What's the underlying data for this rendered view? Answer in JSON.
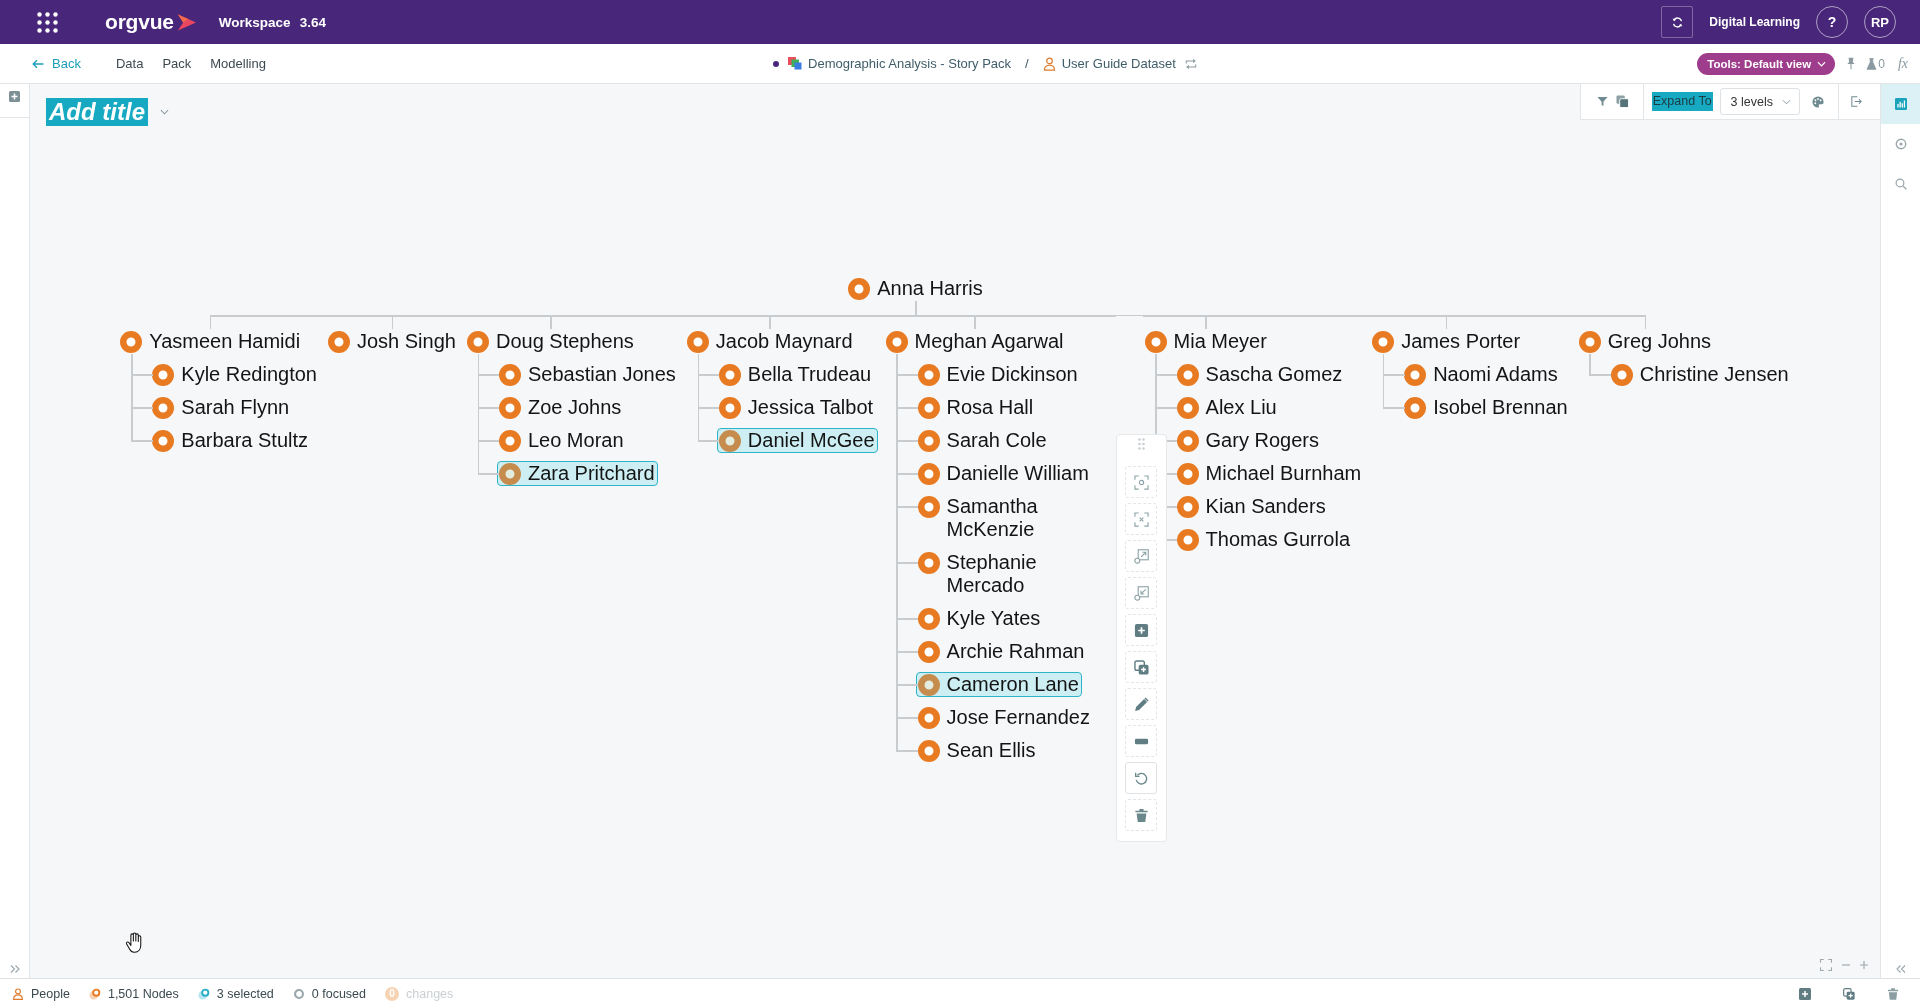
{
  "header": {
    "app_name": "orgvue",
    "product": "Workspace",
    "version": "3.64",
    "organisation": "Digital Learning",
    "help": "?",
    "avatar_initials": "RP"
  },
  "subbar": {
    "back": "Back",
    "nav": [
      "Data",
      "Pack",
      "Modelling"
    ],
    "breadcrumb": {
      "pack": "Demographic Analysis - Story Pack",
      "separator": "/",
      "dataset": "User Guide Dataset"
    },
    "tools_button": "Tools: Default view",
    "flask_count": "0",
    "formula": "fx"
  },
  "canvas": {
    "title": {
      "text": "Add title",
      "highlighted": true
    },
    "toolbar": {
      "expand_to": {
        "label": "Expand To",
        "highlighted": true
      },
      "levels": "3 levels"
    }
  },
  "side_panel": {
    "tabs": [
      {
        "selected": true
      },
      {
        "selected": false
      },
      {
        "selected": false
      }
    ]
  },
  "tree": {
    "name": "Anna Harris",
    "selected": false,
    "children": [
      {
        "name": "Yasmeen Hamidi",
        "selected": false,
        "children": [
          {
            "name": "Kyle Redington",
            "selected": false
          },
          {
            "name": "Sarah Flynn",
            "selected": false
          },
          {
            "name": "Barbara Stultz",
            "selected": false
          }
        ]
      },
      {
        "name": "Josh Singh",
        "selected": false
      },
      {
        "name": "Doug Stephens",
        "selected": false,
        "children": [
          {
            "name": "Sebastian Jones",
            "selected": false
          },
          {
            "name": "Zoe Johns",
            "selected": false
          },
          {
            "name": "Leo Moran",
            "selected": false
          },
          {
            "name": "Zara Pritchard",
            "selected": true
          }
        ]
      },
      {
        "name": "Jacob Maynard",
        "selected": false,
        "children": [
          {
            "name": "Bella Trudeau",
            "selected": false
          },
          {
            "name": "Jessica Talbot",
            "selected": false
          },
          {
            "name": "Daniel McGee",
            "selected": true
          }
        ]
      },
      {
        "name": "Meghan Agarwal",
        "selected": false,
        "children": [
          {
            "name": "Evie Dickinson",
            "selected": false
          },
          {
            "name": "Rosa Hall",
            "selected": false
          },
          {
            "name": "Sarah Cole",
            "selected": false
          },
          {
            "name": "Danielle William",
            "selected": false
          },
          {
            "name": "Samantha McKenzie",
            "selected": false
          },
          {
            "name": "Stephanie Mercado",
            "selected": false
          },
          {
            "name": "Kyle Yates",
            "selected": false
          },
          {
            "name": "Archie Rahman",
            "selected": false
          },
          {
            "name": "Cameron Lane",
            "selected": true
          },
          {
            "name": "Jose Fernandez",
            "selected": false
          },
          {
            "name": "Sean Ellis",
            "selected": false
          }
        ]
      },
      {
        "name": "Mia Meyer",
        "selected": false,
        "children": [
          {
            "name": "Sascha Gomez",
            "selected": false
          },
          {
            "name": "Alex Liu",
            "selected": false
          },
          {
            "name": "Gary Rogers",
            "selected": false
          },
          {
            "name": "Michael Burnham",
            "selected": false
          },
          {
            "name": "Kian Sanders",
            "selected": false
          },
          {
            "name": "Thomas Gurrola",
            "selected": false
          }
        ]
      },
      {
        "name": "James Porter",
        "selected": false,
        "children": [
          {
            "name": "Naomi Adams",
            "selected": false
          },
          {
            "name": "Isobel Brennan",
            "selected": false
          }
        ]
      },
      {
        "name": "Greg Johns",
        "selected": false,
        "children": [
          {
            "name": "Christine Jensen",
            "selected": false
          }
        ]
      }
    ]
  },
  "status_bar": {
    "items": [
      {
        "kind": "dataset",
        "label": "People",
        "disabled": false
      },
      {
        "kind": "nodes",
        "label": "1,501 Nodes",
        "disabled": false
      },
      {
        "kind": "selection",
        "label": "3 selected",
        "disabled": false
      },
      {
        "kind": "focus",
        "label": "0 focused",
        "disabled": false
      },
      {
        "kind": "changes",
        "badge": "0",
        "label": "changes",
        "disabled": true
      }
    ]
  }
}
